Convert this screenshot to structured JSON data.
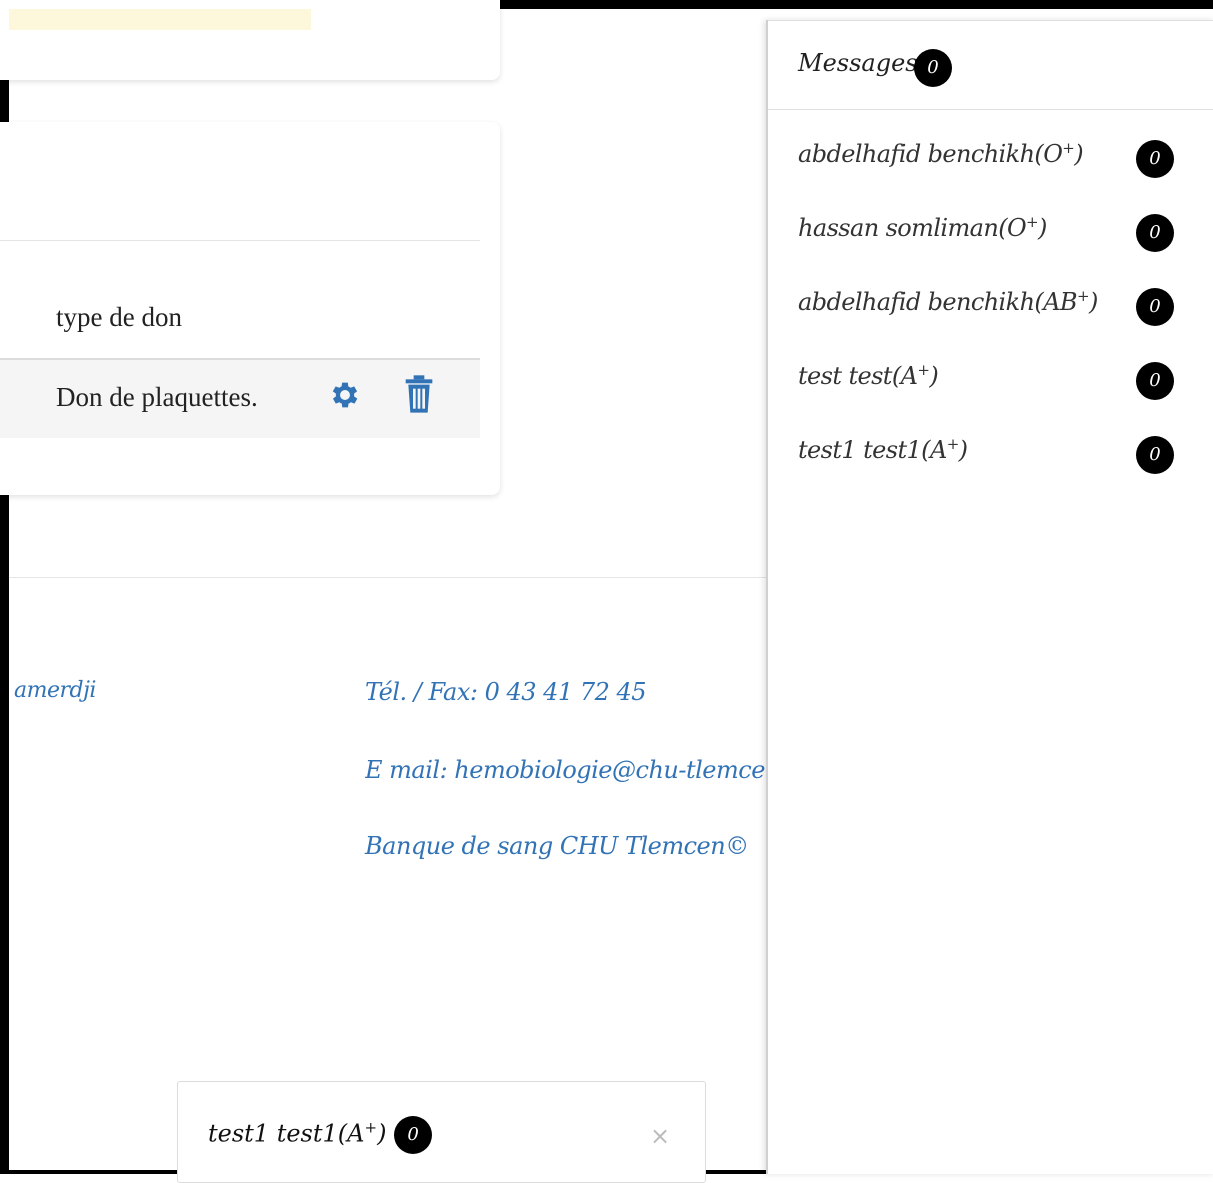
{
  "table": {
    "header_type": "type de don",
    "rows": [
      {
        "type": "Don de plaquettes."
      }
    ]
  },
  "footer": {
    "name_fragment": "amerdji",
    "tel": "Tél. / Fax: 0 43 41 72 45",
    "email": "E mail: hemobiologie@chu-tlemcen",
    "copyright": "Banque de sang CHU Tlemcen©"
  },
  "chat": {
    "name": "test1 test1(A",
    "sup": "+",
    "suffix": ")",
    "count": "0",
    "close_symbol": "×"
  },
  "messages": {
    "title": "Messages",
    "count": "0",
    "contacts": [
      {
        "name": "abdelhafid benchikh(O",
        "sup": "+",
        "suffix": ")",
        "count": "0"
      },
      {
        "name": "hassan somliman(O",
        "sup": "+",
        "suffix": ")",
        "count": "0"
      },
      {
        "name": "abdelhafid benchikh(AB",
        "sup": "+",
        "suffix": ")",
        "count": "0"
      },
      {
        "name": "test test(A",
        "sup": "+",
        "suffix": ")",
        "count": "0"
      },
      {
        "name": "test1 test1(A",
        "sup": "+",
        "suffix": ")",
        "count": "0"
      }
    ]
  },
  "colors": {
    "link": "#3273b6",
    "badge": "#000000",
    "row_bg": "#f5f5f5",
    "highlight": "#fdf8dc"
  },
  "icons": {
    "row_edit": "gear-icon",
    "row_delete": "trash-icon",
    "chat_close": "close-icon"
  }
}
